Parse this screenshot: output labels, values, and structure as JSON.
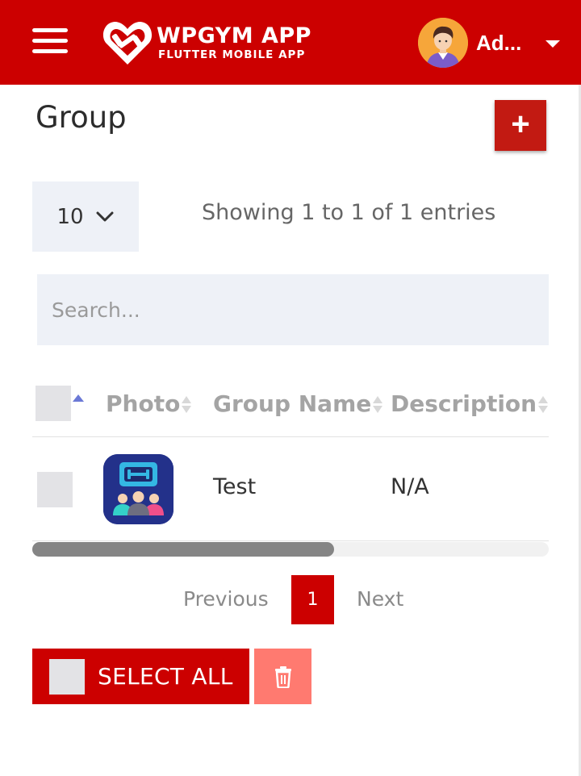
{
  "header": {
    "brand_title": "WPGYM APP",
    "brand_subtitle": "FLUTTER MOBILE APP",
    "user_name": "Ad...",
    "icons": {
      "menu": "hamburger-menu-icon",
      "logo": "heart-dumbbell-logo-icon",
      "caret": "caret-down-icon"
    },
    "brand_color": "#cc0000"
  },
  "page": {
    "title": "Group",
    "add_label": "+"
  },
  "table_controls": {
    "page_length": "10",
    "info": "Showing 1 to 1 of 1 entries",
    "search_placeholder": "Search..."
  },
  "table": {
    "columns": [
      "Photo",
      "Group Name",
      "Description"
    ],
    "rows": [
      {
        "group_name": "Test",
        "description": "N/A"
      }
    ]
  },
  "pagination": {
    "previous": "Previous",
    "current": "1",
    "next": "Next"
  },
  "bulk_actions": {
    "select_all": "SELECT ALL",
    "delete_icon": "trash-icon",
    "delete_color": "#ff7a70"
  }
}
